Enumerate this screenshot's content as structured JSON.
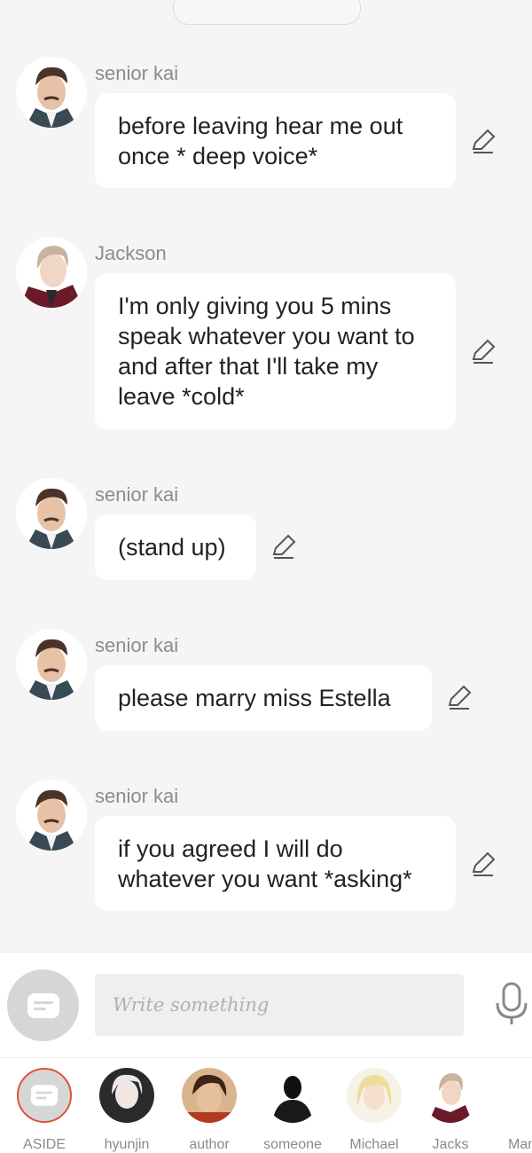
{
  "messages": [
    {
      "sender": "senior kai",
      "text": "before leaving hear me out once * deep voice*",
      "avatar": "senior-kai"
    },
    {
      "sender": "Jackson",
      "text": "I'm only giving you 5 mins speak whatever you want to and after that I'll take my leave *cold*",
      "avatar": "jackson"
    },
    {
      "sender": "senior kai",
      "text": "(stand up)",
      "avatar": "senior-kai"
    },
    {
      "sender": "senior kai",
      "text": "please marry miss Estella",
      "avatar": "senior-kai"
    },
    {
      "sender": "senior kai",
      "text": "if you agreed I will do whatever you want *asking*",
      "avatar": "senior-kai"
    }
  ],
  "composer": {
    "placeholder": "Write something",
    "aside_icon": "chat-bubble-icon",
    "mic_icon": "microphone-icon"
  },
  "characters": [
    {
      "name": "ASIDE",
      "selected": true
    },
    {
      "name": "hyunjin"
    },
    {
      "name": "author"
    },
    {
      "name": "someone"
    },
    {
      "name": "Michael"
    },
    {
      "name": "Jacks"
    },
    {
      "name": "Mana"
    }
  ],
  "colors": {
    "background": "#f5f5f5",
    "bubble": "#ffffff",
    "selected_ring": "#e0523a"
  }
}
